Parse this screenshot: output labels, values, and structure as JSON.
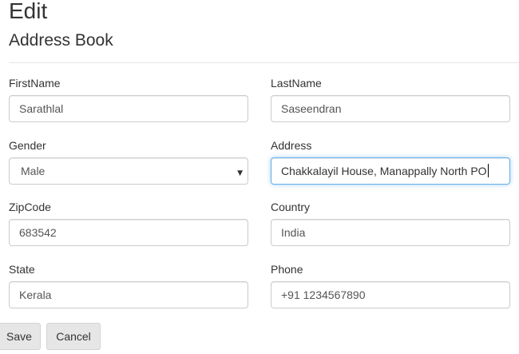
{
  "header": {
    "title": "Edit",
    "subtitle": "Address Book"
  },
  "form": {
    "firstname": {
      "label": "FirstName",
      "value": "Sarathlal"
    },
    "lastname": {
      "label": "LastName",
      "value": "Saseendran"
    },
    "gender": {
      "label": "Gender",
      "value": "Male"
    },
    "address": {
      "label": "Address",
      "value": "Chakkalayil House, Manappally North PO"
    },
    "zipcode": {
      "label": "ZipCode",
      "value": "683542"
    },
    "country": {
      "label": "Country",
      "value": "India"
    },
    "state": {
      "label": "State",
      "value": "Kerala"
    },
    "phone": {
      "label": "Phone",
      "value": "+91 1234567890"
    }
  },
  "actions": {
    "save_label": "Save",
    "cancel_label": "Cancel"
  },
  "icons": {
    "select_caret": "▼"
  },
  "colors": {
    "focus_border": "#66afe9",
    "button_bg": "#e6e6e6",
    "input_border": "#cccccc"
  }
}
